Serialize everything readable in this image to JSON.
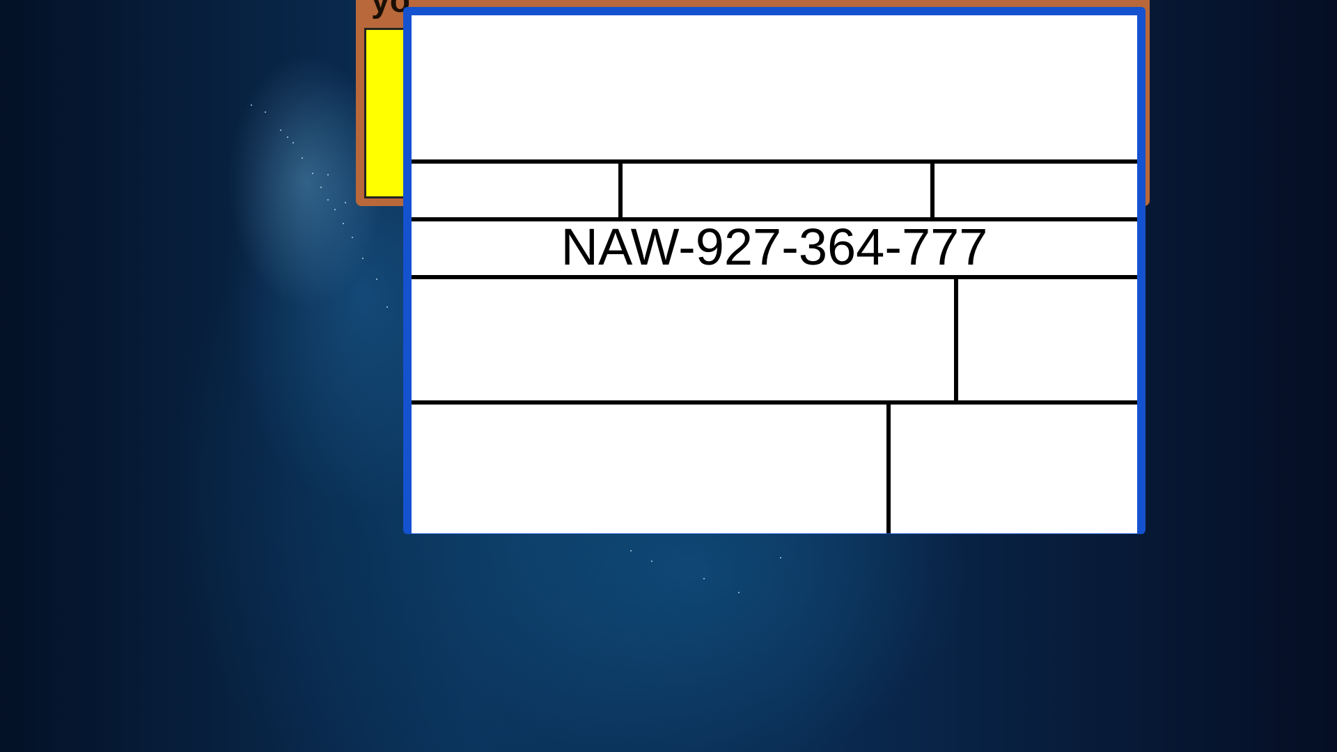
{
  "background_window": {
    "title": "yo",
    "content_color": "#ffff00",
    "frame_color": "#b8683a"
  },
  "main_window": {
    "frame_color": "#1552cf",
    "id_label": "NAW-927-364-777"
  }
}
